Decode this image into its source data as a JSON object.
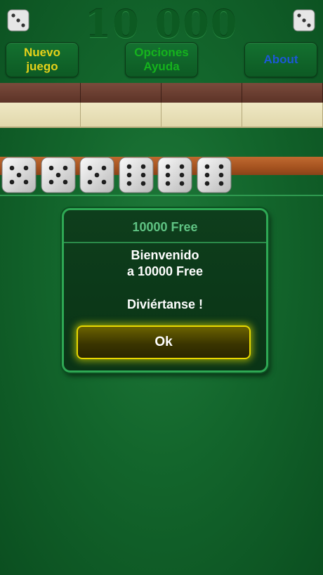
{
  "header": {
    "title": "10 000",
    "new_game_line1": "Nuevo",
    "new_game_line2": "juego",
    "options_line1": "Opciones",
    "options_line2": "Ayuda",
    "about": "About"
  },
  "colors": {
    "new_game_text": "#e6d21a",
    "options_text": "#15b31d",
    "about_text": "#1c58d6"
  },
  "dice": [
    5,
    5,
    5,
    6,
    6,
    6
  ],
  "dialog": {
    "title": "10000 Free",
    "line1": "Bienvenido",
    "line2": "a 10000 Free",
    "line3": "Diviértanse !",
    "ok": "Ok"
  }
}
